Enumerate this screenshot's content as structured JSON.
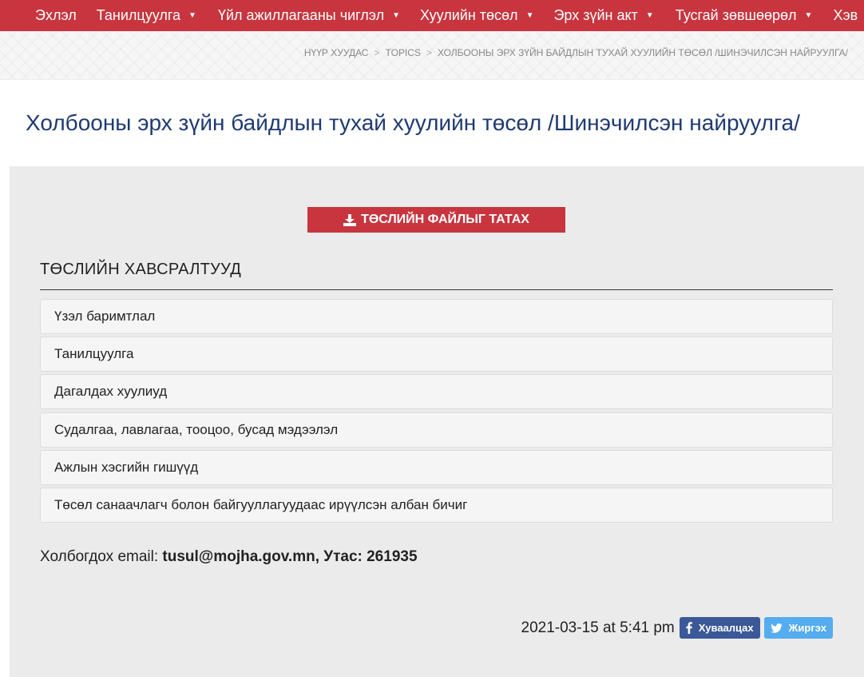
{
  "nav": {
    "items": [
      {
        "label": "Эхлэл",
        "dropdown": false
      },
      {
        "label": "Танилцуулга",
        "dropdown": true
      },
      {
        "label": "Үйл ажиллагааны чиглэл",
        "dropdown": true
      },
      {
        "label": "Хуулийн төсөл",
        "dropdown": true
      },
      {
        "label": "Эрх зүйн акт",
        "dropdown": true
      },
      {
        "label": "Тусгай зөвшөөрөл",
        "dropdown": true
      },
      {
        "label": "Хэв",
        "dropdown": false
      }
    ]
  },
  "breadcrumb": {
    "home": "Нүүр хуудас",
    "topics": "Topics",
    "current": "Холбооны эрх зүйн байдлын тухай хуулийн төсөл /Шинэчилсэн найруулга/"
  },
  "page": {
    "title": "Холбооны эрх зүйн байдлын тухай хуулийн төсөл /Шинэчилсэн найруулга/"
  },
  "download": {
    "label": "Төслийн файлыг татах"
  },
  "attachments": {
    "heading": "Төслийн хавсралтууд",
    "items": [
      "Үзэл баримтлал",
      "Танилцуулга",
      "Дагалдах хуулиуд",
      "Судалгаа, лавлагаа, тооцоо, бусад мэдээлэл",
      "Ажлын хэсгийн гишүүд",
      "Төсөл санаачлагч болон байгууллагуудаас ирүүлсэн албан бичиг"
    ]
  },
  "contact": {
    "prefix": "Холбогдох email: ",
    "value": "tusul@mojha.gov.mn, Утас: 261935"
  },
  "footer": {
    "timestamp": "2021-03-15 at 5:41 pm",
    "share_facebook": "Хуваалцах",
    "share_twitter": "Жиргэх"
  },
  "colors": {
    "brand": "#c8353f",
    "title": "#1f3a73",
    "facebook": "#3b5998",
    "twitter": "#55acee"
  },
  "icons": {
    "download": "download-icon",
    "facebook": "facebook-icon",
    "twitter": "twitter-icon",
    "caret": "caret-down-icon"
  }
}
